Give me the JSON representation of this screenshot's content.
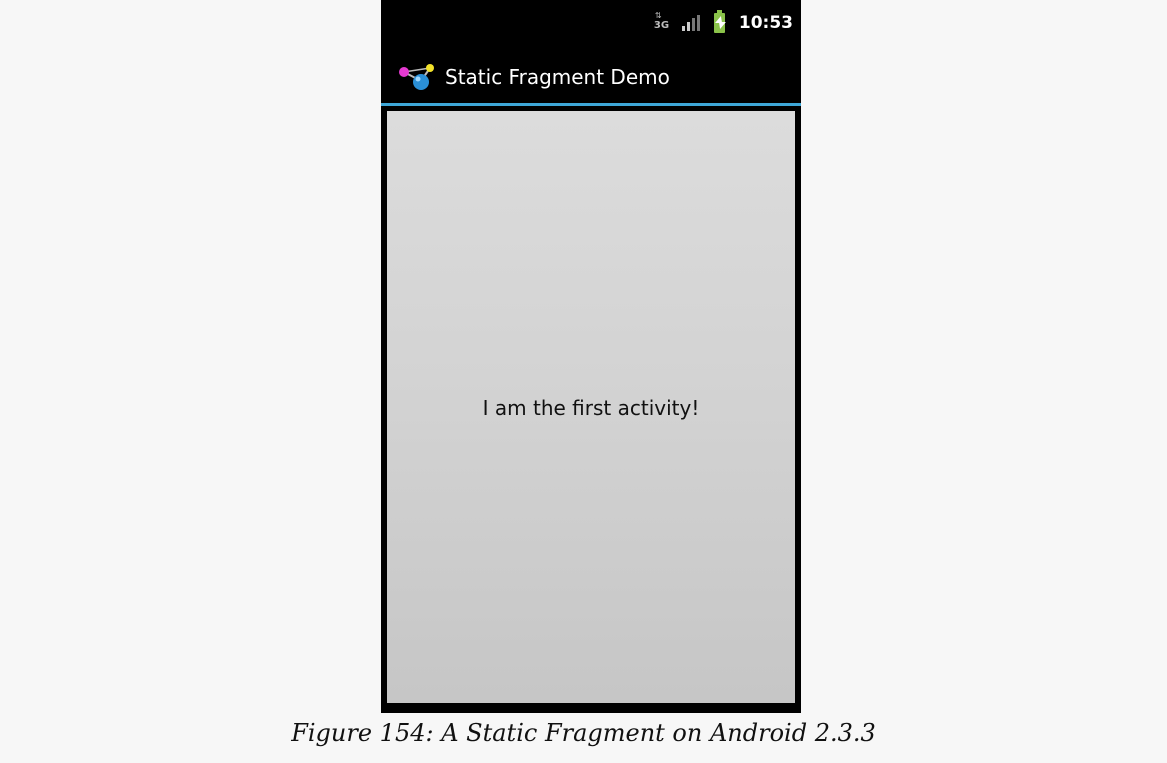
{
  "status_bar": {
    "network_label": "3G",
    "network_arrows": "⇅",
    "time": "10:53",
    "icons": [
      "network-3g-icon",
      "signal-icon",
      "battery-charging-icon"
    ]
  },
  "title_bar": {
    "app_icon": "app-molecule-icon",
    "title": "Static Fragment Demo",
    "accent_color": "#3ea7d8"
  },
  "content": {
    "text": "I am the first activity!"
  },
  "caption": "Figure 154: A Static Fragment on Android 2.3.3"
}
